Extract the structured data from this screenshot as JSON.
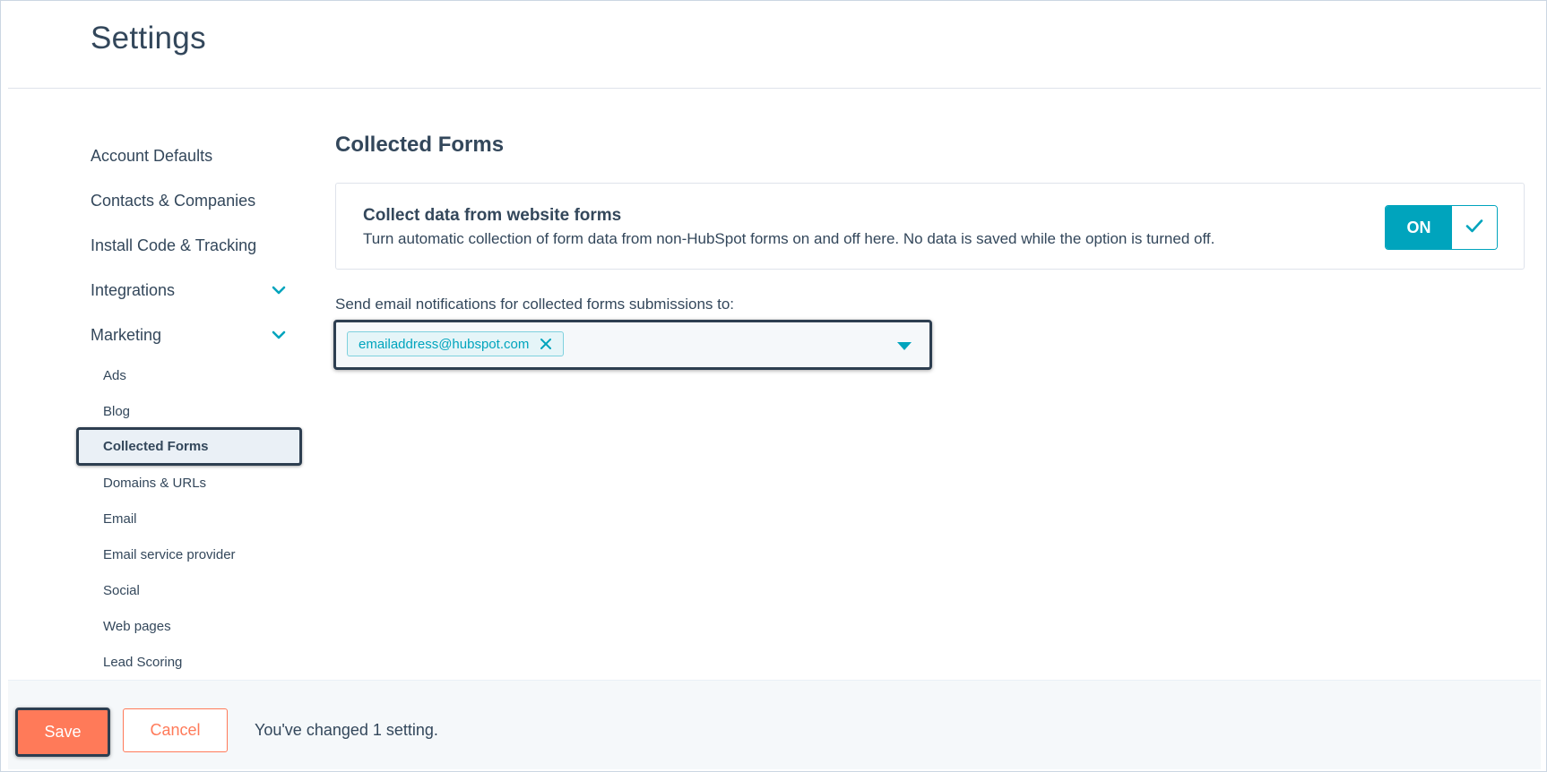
{
  "page": {
    "title": "Settings"
  },
  "sidebar": {
    "items": [
      {
        "label": "Account Defaults"
      },
      {
        "label": "Contacts & Companies"
      },
      {
        "label": "Install Code & Tracking"
      },
      {
        "label": "Integrations",
        "expandable": true
      },
      {
        "label": "Marketing",
        "expandable": true
      }
    ],
    "marketing_subitems": [
      {
        "label": "Ads"
      },
      {
        "label": "Blog"
      },
      {
        "label": "Collected Forms",
        "active": true
      },
      {
        "label": "Domains & URLs"
      },
      {
        "label": "Email"
      },
      {
        "label": "Email service provider"
      },
      {
        "label": "Social"
      },
      {
        "label": "Web pages"
      },
      {
        "label": "Lead Scoring"
      }
    ]
  },
  "main": {
    "section_title": "Collected Forms",
    "card": {
      "heading": "Collect data from website forms",
      "description": "Turn automatic collection of form data from non-HubSpot forms on and off here. No data is saved while the option is turned off.",
      "toggle_label": "ON",
      "toggle_state": "on"
    },
    "notifications": {
      "label": "Send email notifications for collected forms submissions to:",
      "selected_tag": "emailaddress@hubspot.com"
    }
  },
  "footer": {
    "save_label": "Save",
    "cancel_label": "Cancel",
    "status": "You've changed 1 setting."
  },
  "colors": {
    "text": "#33475b",
    "accent": "#00a4bd",
    "primary_button": "#ff7a59",
    "highlight_border": "#2d3e50"
  },
  "icons": {
    "chevron": "chevron-down-icon",
    "check": "check-icon",
    "remove": "close-icon",
    "dropdown": "caret-down-icon"
  }
}
